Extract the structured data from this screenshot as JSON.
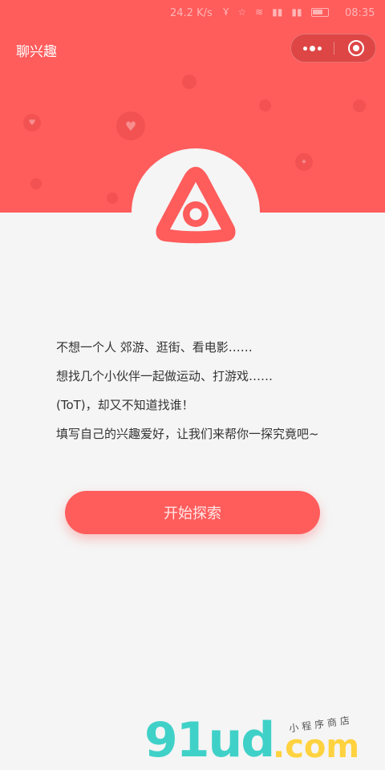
{
  "status_bar": {
    "network_speed": "24.2 K/s",
    "time": "08:35"
  },
  "app": {
    "title": "聊兴趣"
  },
  "intro_lines": [
    "不想一个人 郊游、逛街、看电影……",
    "想找几个小伙伴一起做运动、打游戏……",
    "(ToT)，却又不知道找谁！",
    "填写自己的兴趣爱好，让我们来帮你一探究竟吧~"
  ],
  "start_button": {
    "label": "开始探索"
  },
  "watermark": {
    "main": "91ud",
    "domain": ".com",
    "sub": "小程序商店"
  },
  "colors": {
    "primary": "#ff5c5c",
    "background": "#f5f5f5",
    "text": "#333333"
  },
  "icons": {
    "logo": "rounded-triangle-eye-icon",
    "capsule_more": "more-dots-icon",
    "capsule_close": "target-circle-icon"
  }
}
